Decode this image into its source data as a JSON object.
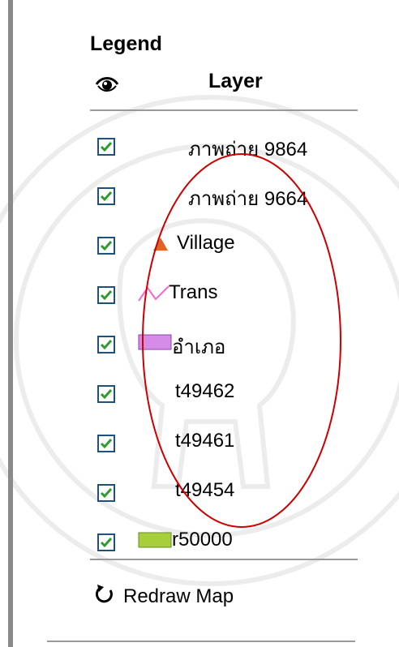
{
  "legend": {
    "title": "Legend",
    "visibility_icon": "eye-icon",
    "column_header": "Layer",
    "layers": [
      {
        "label": "ภาพถ่าย 9864",
        "checked": true,
        "symbol": "none"
      },
      {
        "label": "ภาพถ่าย 9664",
        "checked": true,
        "symbol": "none"
      },
      {
        "label": "Village",
        "checked": true,
        "symbol": "triangle-icon",
        "color": "#e0622a"
      },
      {
        "label": "Trans",
        "checked": true,
        "symbol": "line-icon",
        "color": "#ff66cc"
      },
      {
        "label": "อำเภอ",
        "checked": true,
        "symbol": "polygon-swatch",
        "color": "#d58be8"
      },
      {
        "label": "t49462",
        "checked": true,
        "symbol": "none"
      },
      {
        "label": "t49461",
        "checked": true,
        "symbol": "none"
      },
      {
        "label": "t49454",
        "checked": true,
        "symbol": "none"
      },
      {
        "label": "r50000",
        "checked": true,
        "symbol": "polygon-swatch",
        "color": "#a7cf3c"
      }
    ],
    "redraw": {
      "label": "Redraw Map",
      "icon": "redraw-icon"
    }
  },
  "colors": {
    "checkbox_border": "#1c5180",
    "checkmark": "#2e9b2e",
    "annotation_ellipse": "#cc0000",
    "divider": "#9a9a9a"
  }
}
